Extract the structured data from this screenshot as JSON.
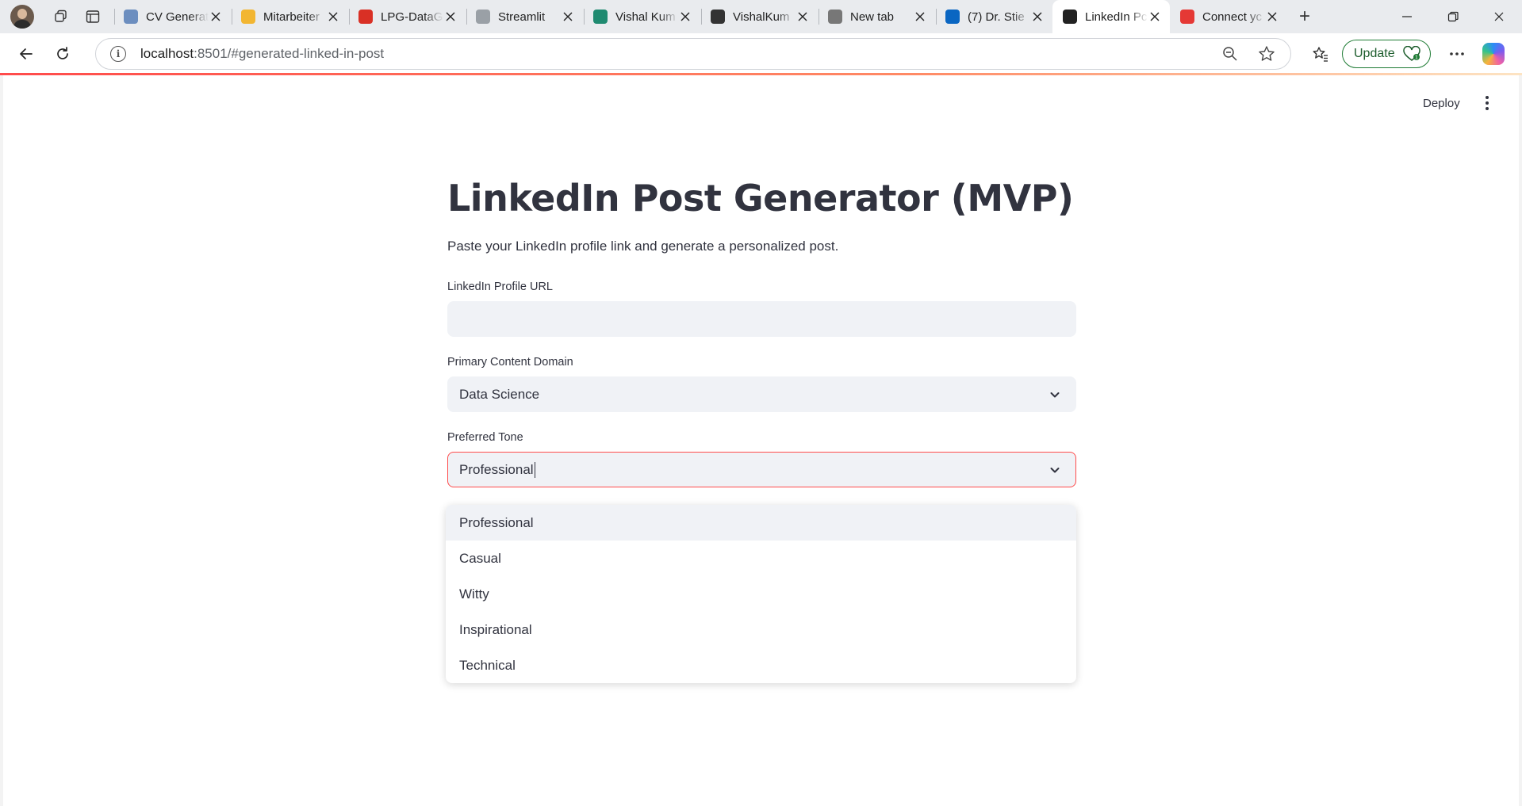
{
  "browser": {
    "tabs": [
      {
        "title": "CV Generat",
        "favicon": "streamlit-blue-icon",
        "color": "#6c8ebf"
      },
      {
        "title": "Mitarbeiter",
        "favicon": "mcdonalds-icon",
        "color": "#f2b632"
      },
      {
        "title": "LPG-DataG",
        "favicon": "pdf-icon",
        "color": "#d93025"
      },
      {
        "title": "Streamlit",
        "favicon": "streamlit-icon",
        "color": "#9aa0a6"
      },
      {
        "title": "Vishal Kum",
        "favicon": "xing-icon",
        "color": "#1f8a70"
      },
      {
        "title": "VishalKum",
        "favicon": "github-icon",
        "color": "#333333"
      },
      {
        "title": "New tab",
        "favicon": "newtab-icon",
        "color": "#777777"
      },
      {
        "title": "(7) Dr. Stie",
        "favicon": "linkedin-icon",
        "color": "#0a66c2"
      },
      {
        "title": "LinkedIn Pc",
        "favicon": "streamlit-crown-icon",
        "color": "#222222",
        "active": true
      },
      {
        "title": "Connect yc",
        "favicon": "streamlit-red-crown-icon",
        "color": "#e53935"
      }
    ],
    "url_host": "localhost",
    "url_rest": ":8501/#generated-linked-in-post",
    "update_label": "Update"
  },
  "app": {
    "deploy_label": "Deploy",
    "title": "LinkedIn Post Generator (MVP)",
    "subtitle": "Paste your LinkedIn profile link and generate a personalized post.",
    "url_field": {
      "label": "LinkedIn Profile URL",
      "value": ""
    },
    "domain_field": {
      "label": "Primary Content Domain",
      "value": "Data Science"
    },
    "tone_field": {
      "label": "Preferred Tone",
      "value": "Professional",
      "options": [
        "Professional",
        "Casual",
        "Witty",
        "Inspirational",
        "Technical"
      ],
      "highlighted": "Professional"
    }
  },
  "colors": {
    "accent": "#ff4b4b",
    "input_bg": "#f0f2f6",
    "text": "#31333f"
  }
}
